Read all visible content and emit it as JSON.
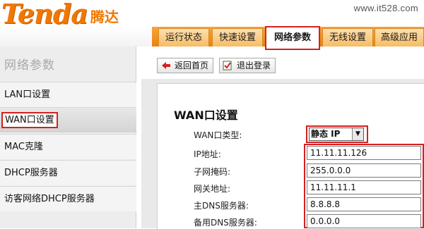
{
  "brand": {
    "logo_word": "Tenda",
    "logo_cn": "腾达",
    "watermark": "www.it528.com"
  },
  "nav": {
    "tabs": [
      {
        "label": "运行状态"
      },
      {
        "label": "快速设置"
      },
      {
        "label": "网络参数"
      },
      {
        "label": "无线设置"
      },
      {
        "label": "高级应用"
      }
    ],
    "active": "网络参数"
  },
  "sidebar": {
    "title": "网络参数",
    "items": [
      {
        "label": "LAN口设置"
      },
      {
        "label": "WAN口设置"
      },
      {
        "label": "MAC克隆"
      },
      {
        "label": "DHCP服务器"
      },
      {
        "label": "访客网络DHCP服务器"
      }
    ],
    "active": "WAN口设置"
  },
  "toolbar": {
    "home_label": "返回首页",
    "logout_label": "退出登录"
  },
  "wan": {
    "title": "WAN口设置",
    "type_label": "WAN口类型:",
    "type_value": "静态 IP",
    "ip_label": "IP地址:",
    "ip_value": "11.11.11.126",
    "mask_label": "子网掩码:",
    "mask_value": "255.0.0.0",
    "gateway_label": "网关地址:",
    "gateway_value": "11.11.11.1",
    "dns1_label": "主DNS服务器:",
    "dns1_value": "8.8.8.8",
    "dns2_label": "备用DNS服务器:",
    "dns2_value": "0.0.0.0"
  },
  "colors": {
    "accent": "#f07800",
    "highlight": "#d42020"
  },
  "icons": {
    "home": "back-home-icon",
    "logout": "logout-icon",
    "dropdown": "chevron-down-icon"
  }
}
